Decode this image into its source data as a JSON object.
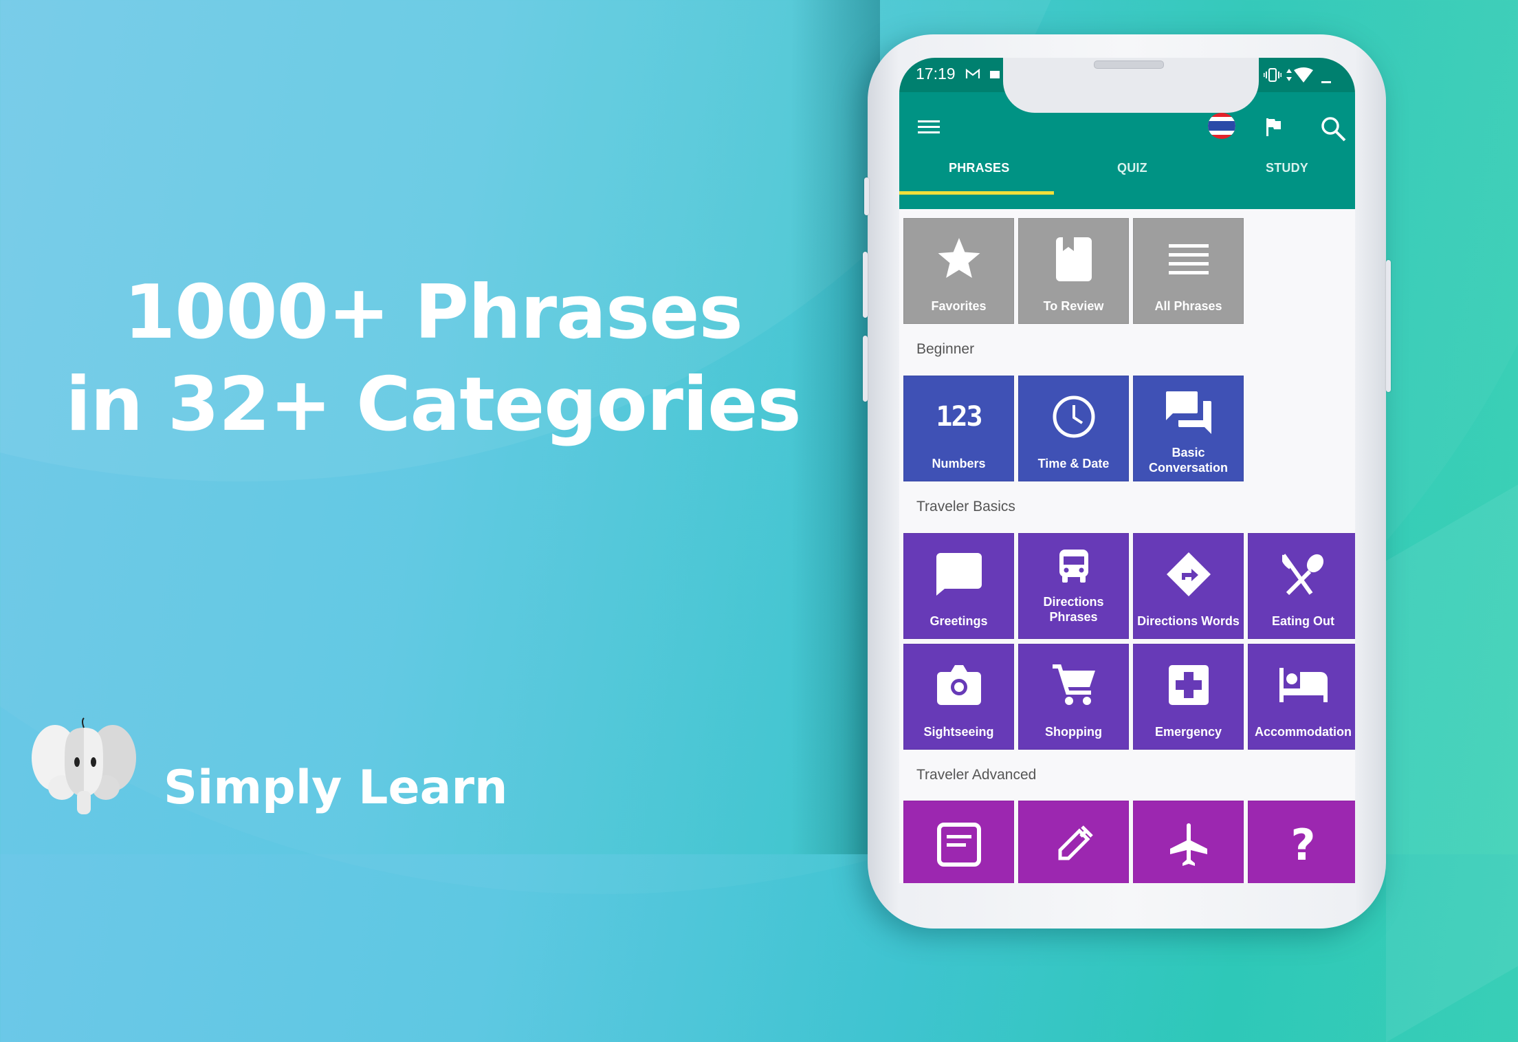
{
  "promo": {
    "headline_line1": "1000+ Phrases",
    "headline_line2": "in 32+ Categories",
    "brand_name": "Simply Learn"
  },
  "status_bar": {
    "time": "17:19",
    "icons": [
      "gmail-icon",
      "battery-saver-icon",
      "vibrate-icon",
      "data-arrows-icon",
      "wifi-icon",
      "battery-icon"
    ]
  },
  "app_bar": {
    "language_flag": "thailand-flag",
    "icons": [
      "menu-icon",
      "flag-icon",
      "search-icon"
    ]
  },
  "tabs": [
    {
      "label": "PHRASES",
      "active": true
    },
    {
      "label": "QUIZ",
      "active": false
    },
    {
      "label": "STUDY",
      "active": false
    }
  ],
  "colors": {
    "app_bar": "#009384",
    "status_bar": "#00806f",
    "tab_indicator": "#f2df3a",
    "tile_gray": "#9e9e9e",
    "tile_beginner": "#3f51b5",
    "tile_traveler_basics": "#673ab7",
    "tile_traveler_advanced": "#9c27b0"
  },
  "quick_tiles": [
    {
      "label": "Favorites",
      "icon": "star-icon"
    },
    {
      "label": "To Review",
      "icon": "bookmark-icon"
    },
    {
      "label": "All Phrases",
      "icon": "list-icon"
    }
  ],
  "sections": [
    {
      "title": "Beginner",
      "tiles": [
        {
          "label": "Numbers",
          "icon": "numbers-icon",
          "icon_text": "123"
        },
        {
          "label": "Time & Date",
          "icon": "clock-icon"
        },
        {
          "label_line1": "Basic",
          "label_line2": "Conversation",
          "icon": "chat-icon"
        }
      ]
    },
    {
      "title": "Traveler Basics",
      "tiles": [
        {
          "label": "Greetings",
          "icon": "speech-bubble-icon"
        },
        {
          "label_line1": "Directions",
          "label_line2": "Phrases",
          "icon": "bus-icon"
        },
        {
          "label": "Directions Words",
          "icon": "directions-sign-icon"
        },
        {
          "label": "Eating Out",
          "icon": "utensils-icon"
        },
        {
          "label": "Sightseeing",
          "icon": "camera-icon"
        },
        {
          "label": "Shopping",
          "icon": "cart-icon"
        },
        {
          "label": "Emergency",
          "icon": "first-aid-icon"
        },
        {
          "label": "Accommodation",
          "icon": "bed-icon"
        }
      ]
    },
    {
      "title": "Traveler Advanced",
      "tiles": [
        {
          "icon": "document-icon"
        },
        {
          "icon": "syringe-icon"
        },
        {
          "icon": "airplane-icon"
        },
        {
          "icon": "question-icon"
        }
      ]
    }
  ]
}
